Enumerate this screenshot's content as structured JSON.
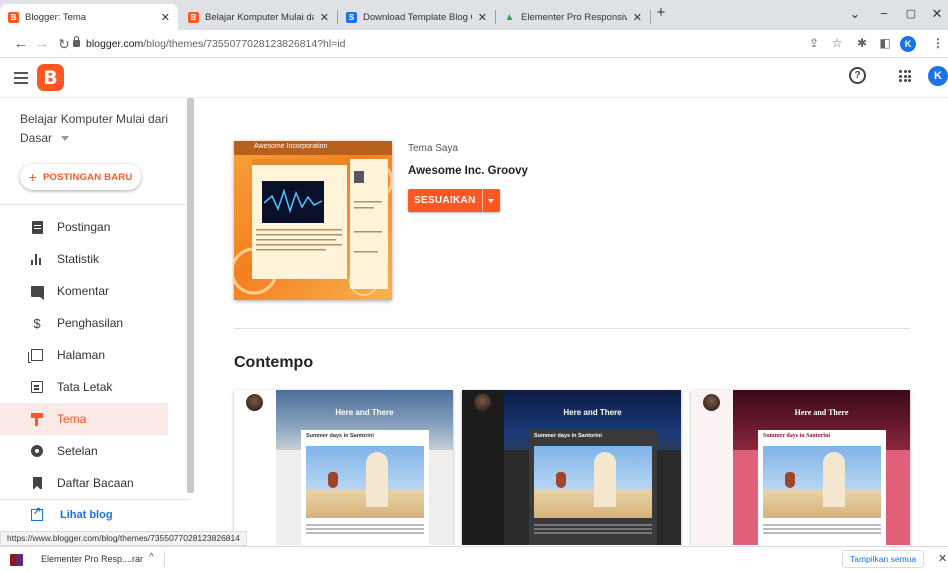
{
  "browser": {
    "tabs": [
      {
        "title": "Blogger: Tema",
        "active": true,
        "favicon_color": "#ff5722",
        "favicon_glyph": "B"
      },
      {
        "title": "Belajar Komputer Mulai dari Das",
        "active": false,
        "favicon_color": "#ff5722",
        "favicon_glyph": "B"
      },
      {
        "title": "Download Template Blog Gratis",
        "active": false,
        "favicon_color": "#1a73e8",
        "favicon_glyph": "S"
      },
      {
        "title": "Elementer Pro Responsive Blogg",
        "active": false,
        "favicon_color": "#34a853",
        "favicon_glyph": "▲"
      }
    ],
    "new_tab_glyph": "+",
    "window_controls": [
      "⌄",
      "−",
      "▢",
      "✕"
    ],
    "url_domain": "blogger.com",
    "url_path": "/blog/themes/7355077028123826814?hl=id",
    "profile_initial": "K",
    "icons": [
      "share-icon",
      "star-icon",
      "extensions-icon",
      "sidepanel-icon",
      "profile-icon",
      "menu-icon"
    ]
  },
  "app": {
    "profile_initial": "K",
    "help_glyph": "?",
    "logo_glyph": "B"
  },
  "sidebar": {
    "blog_name": "Belajar Komputer Mulai dari Dasar",
    "new_post_plus": "+",
    "new_post_label": "POSTINGAN BARU",
    "items": [
      {
        "label": "Postingan",
        "icon": "posts-icon"
      },
      {
        "label": "Statistik",
        "icon": "stats-icon"
      },
      {
        "label": "Komentar",
        "icon": "comments-icon"
      },
      {
        "label": "Penghasilan",
        "icon": "earnings-icon",
        "glyph": "$"
      },
      {
        "label": "Halaman",
        "icon": "pages-icon"
      },
      {
        "label": "Tata Letak",
        "icon": "layout-icon"
      },
      {
        "label": "Tema",
        "icon": "theme-icon",
        "active": true
      },
      {
        "label": "Setelan",
        "icon": "settings-icon"
      },
      {
        "label": "Daftar Bacaan",
        "icon": "reading-list-icon"
      },
      {
        "label": "Lihat blog",
        "icon": "view-blog-icon",
        "link": true
      }
    ],
    "accent_color": "#ff5722"
  },
  "main": {
    "my_theme_label": "Tema Saya",
    "theme_name": "Awesome Inc. Groovy",
    "thumb_title": "Awesome Incorporation",
    "customize_label": "SESUAIKAN",
    "section_title": "Contempo",
    "cards": [
      {
        "hero_title": "Here and There",
        "post_title": "Summer days in Santorini",
        "variant": "light"
      },
      {
        "hero_title": "Here and There",
        "post_title": "Summer days in Santorini",
        "variant": "dark"
      },
      {
        "hero_title": "Here and There",
        "post_title": "Summer days in Santorini",
        "variant": "pink"
      }
    ]
  },
  "status": {
    "hover_url": "https://www.blogger.com/blog/themes/7355077028123826814"
  },
  "downloads": {
    "file_name": "Elementer Pro Resp....rar",
    "caret": "^",
    "show_all_label": "Tampilkan semua",
    "close_glyph": "✕"
  }
}
